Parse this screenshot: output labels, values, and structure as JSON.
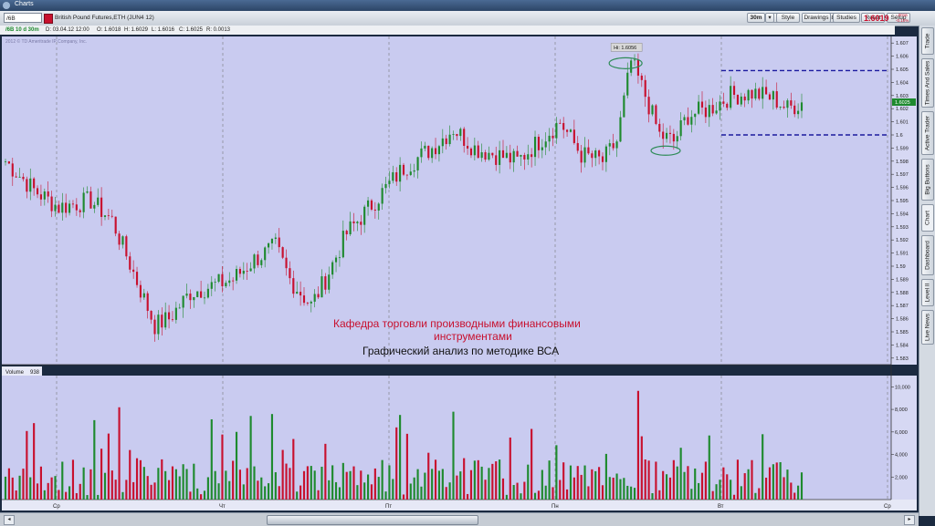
{
  "window": {
    "title": "Charts"
  },
  "toolbar": {
    "symbol": "/6B",
    "description": "British Pound Futures,ETH (JUN4 12)",
    "symbols_label": "Symbols",
    "reset_label": "Reset",
    "setup_label": "Setup",
    "interval_label": "30m",
    "style_label": "Style",
    "drawings_label": "Drawings",
    "studies_label": "Studies",
    "last_price": "1.6019",
    "change_top": "-.0016",
    "change_bottom": "-0.10%"
  },
  "infobar": {
    "label": "/6B 10 d 30m",
    "date": "D: 03.04.12 12:00",
    "open": "O: 1.6018",
    "high": "H: 1.6029",
    "low": "L: 1.6016",
    "close": "C: 1.6025",
    "range": "R: 0.0013"
  },
  "copyright": "2012 © TD Ameritrade IP Company, Inc.",
  "annotations": {
    "high_label": "Hi: 1.6056",
    "current_price_tag": "1.6025",
    "title_line1": "Кафедра торговли производными финансовыми",
    "title_line2": "инструментами",
    "subtitle": "Графический анализ по методике ВСА"
  },
  "volume_pane": {
    "label": "Volume",
    "value": "938"
  },
  "right_tabs": [
    "Trade",
    "Times And Sales",
    "Active Trader",
    "Big Buttons",
    "Chart",
    "Dashboard",
    "Level II",
    "Live News"
  ],
  "colors": {
    "chart_bg": "#c9cbf0",
    "up": "#1e8a2e",
    "down": "#c8102e",
    "resistance": "#1a1a9e",
    "annotation_red": "#c8102e",
    "ellipse": "#2e8b57"
  },
  "chart_data": [
    {
      "type": "candlestick",
      "title": "British Pound Futures,ETH (JUN4 12)",
      "ylim": [
        1.5825,
        1.6075
      ],
      "yticks": [
        1.607,
        1.606,
        1.605,
        1.604,
        1.603,
        1.602,
        1.601,
        1.6,
        1.599,
        1.598,
        1.597,
        1.596,
        1.595,
        1.594,
        1.593,
        1.592,
        1.591,
        1.59,
        1.589,
        1.588,
        1.587,
        1.586,
        1.585,
        1.584,
        1.583
      ],
      "ytick_labels": [
        "1.607",
        "1.606",
        "1.605",
        "1.604",
        "1.603",
        "1.602",
        "1.601",
        "1.6",
        "1.599",
        "1.598",
        "1.597",
        "1.596",
        "1.595",
        "1.594",
        "1.593",
        "1.592",
        "1.591",
        "1.59",
        "1.589",
        "1.588",
        "1.587",
        "1.586",
        "1.585",
        "1.584",
        "1.583"
      ],
      "x_labels": [
        "Ср",
        "Чт",
        "Пт",
        "Пн",
        "Вт",
        "Ср"
      ],
      "anchors": [
        [
          0,
          1.598
        ],
        [
          8,
          1.5958
        ],
        [
          15,
          1.5945
        ],
        [
          24,
          1.595
        ],
        [
          30,
          1.5935
        ],
        [
          36,
          1.5895
        ],
        [
          42,
          1.5855
        ],
        [
          46,
          1.586
        ],
        [
          52,
          1.588
        ],
        [
          58,
          1.5885
        ],
        [
          64,
          1.589
        ],
        [
          70,
          1.5905
        ],
        [
          76,
          1.5915
        ],
        [
          80,
          1.589
        ],
        [
          86,
          1.587
        ],
        [
          90,
          1.589
        ],
        [
          96,
          1.5925
        ],
        [
          104,
          1.595
        ],
        [
          112,
          1.5975
        ],
        [
          120,
          1.599
        ],
        [
          126,
          1.6005
        ],
        [
          132,
          1.599
        ],
        [
          138,
          1.5985
        ],
        [
          144,
          1.598
        ],
        [
          150,
          1.5995
        ],
        [
          156,
          1.601
        ],
        [
          162,
          1.5985
        ],
        [
          168,
          1.598
        ],
        [
          172,
          1.5995
        ],
        [
          176,
          1.6056
        ],
        [
          180,
          1.603
        ],
        [
          184,
          1.6
        ],
        [
          188,
          1.5995
        ],
        [
          192,
          1.6015
        ],
        [
          198,
          1.602
        ],
        [
          204,
          1.603
        ],
        [
          210,
          1.6032
        ],
        [
          216,
          1.6028
        ],
        [
          220,
          1.602
        ],
        [
          224,
          1.6025
        ]
      ],
      "resistance_levels": [
        1.6049,
        1.6
      ],
      "high_marker": 1.6056,
      "current_price": 1.6025
    },
    {
      "type": "bar",
      "series": [
        {
          "name": "Volume",
          "values": []
        }
      ],
      "ylim": [
        0,
        11000
      ],
      "yticks": [
        2000,
        4000,
        6000,
        8000,
        10000
      ],
      "ytick_labels": [
        "2,000",
        "4,000",
        "6,000",
        "8,000",
        "10,000"
      ]
    }
  ]
}
